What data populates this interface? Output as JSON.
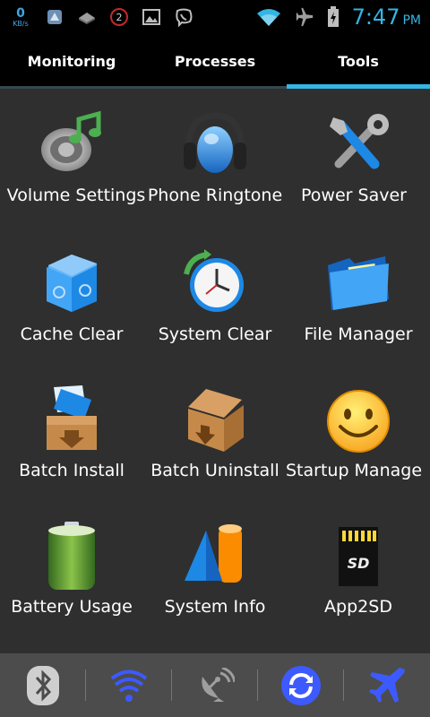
{
  "status_bar": {
    "net_speed_value": "0",
    "net_speed_unit": "KB/s",
    "notification_count": "2",
    "time": "7:47",
    "ampm": "PM",
    "accent": "#33b5e5"
  },
  "tabs": [
    {
      "label": "Monitoring",
      "active": false
    },
    {
      "label": "Processes",
      "active": false
    },
    {
      "label": "Tools",
      "active": true
    }
  ],
  "tools": [
    {
      "label": "Volume Settings",
      "icon": "speaker-music-icon"
    },
    {
      "label": "Phone Ringtone",
      "icon": "headphones-icon"
    },
    {
      "label": "Power Saver",
      "icon": "tools-icon"
    },
    {
      "label": "Cache Clear",
      "icon": "recycle-box-icon"
    },
    {
      "label": "System Clear",
      "icon": "clock-refresh-icon"
    },
    {
      "label": "File Manager",
      "icon": "folder-icon"
    },
    {
      "label": "Batch Install",
      "icon": "box-install-icon"
    },
    {
      "label": "Batch Uninstall",
      "icon": "box-uninstall-icon"
    },
    {
      "label": "Startup Manage",
      "icon": "smiley-icon"
    },
    {
      "label": "Battery Usage",
      "icon": "battery-icon"
    },
    {
      "label": "System Info",
      "icon": "shapes-icon"
    },
    {
      "label": "App2SD",
      "icon": "sd-card-icon"
    }
  ],
  "bottom_bar": [
    {
      "name": "bluetooth-toggle",
      "icon": "bluetooth-icon"
    },
    {
      "name": "wifi-toggle",
      "icon": "wifi-icon"
    },
    {
      "name": "gps-toggle",
      "icon": "satellite-icon"
    },
    {
      "name": "sync-toggle",
      "icon": "sync-icon"
    },
    {
      "name": "airplane-toggle",
      "icon": "airplane-icon"
    }
  ]
}
